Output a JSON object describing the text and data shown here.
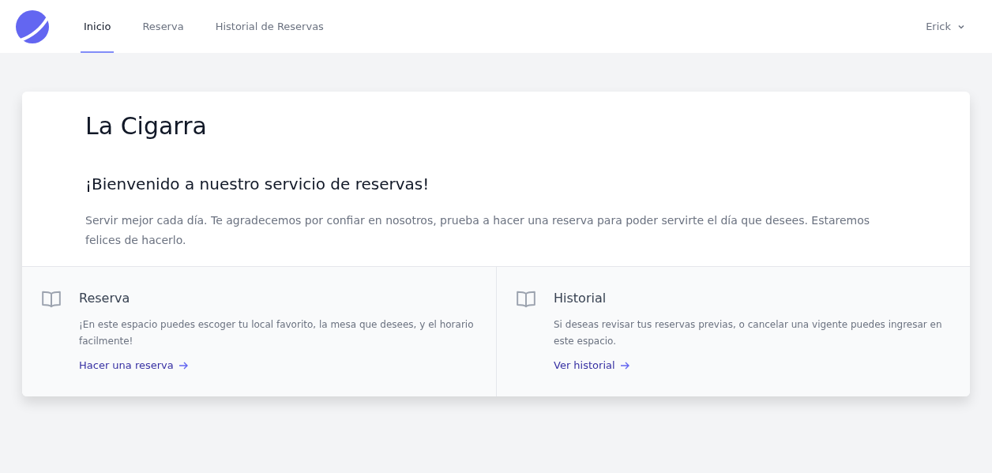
{
  "nav": {
    "tabs": [
      {
        "label": "Inicio",
        "selected": true
      },
      {
        "label": "Reserva",
        "selected": false
      },
      {
        "label": "Historial de Reservas",
        "selected": false
      }
    ],
    "user": "Erick"
  },
  "hero": {
    "title": "La Cigarra",
    "subtitle": "¡Bienvenido a nuestro servicio de reservas!",
    "text": "Servir mejor cada día. Te agradecemos por confiar en nosotros, prueba a hacer una reserva para poder servirte el día que desees. Estaremos felices de hacerlo."
  },
  "sections": [
    {
      "title": "Reserva",
      "text": "¡En este espacio puedes escoger tu local favorito, la mesa que desees, y el horario facilmente!",
      "link": "Hacer una reserva"
    },
    {
      "title": "Historial",
      "text": "Si deseas revisar tus reservas previas, o cancelar una vigente puedes ingresar en este espacio.",
      "link": "Ver historial"
    }
  ]
}
